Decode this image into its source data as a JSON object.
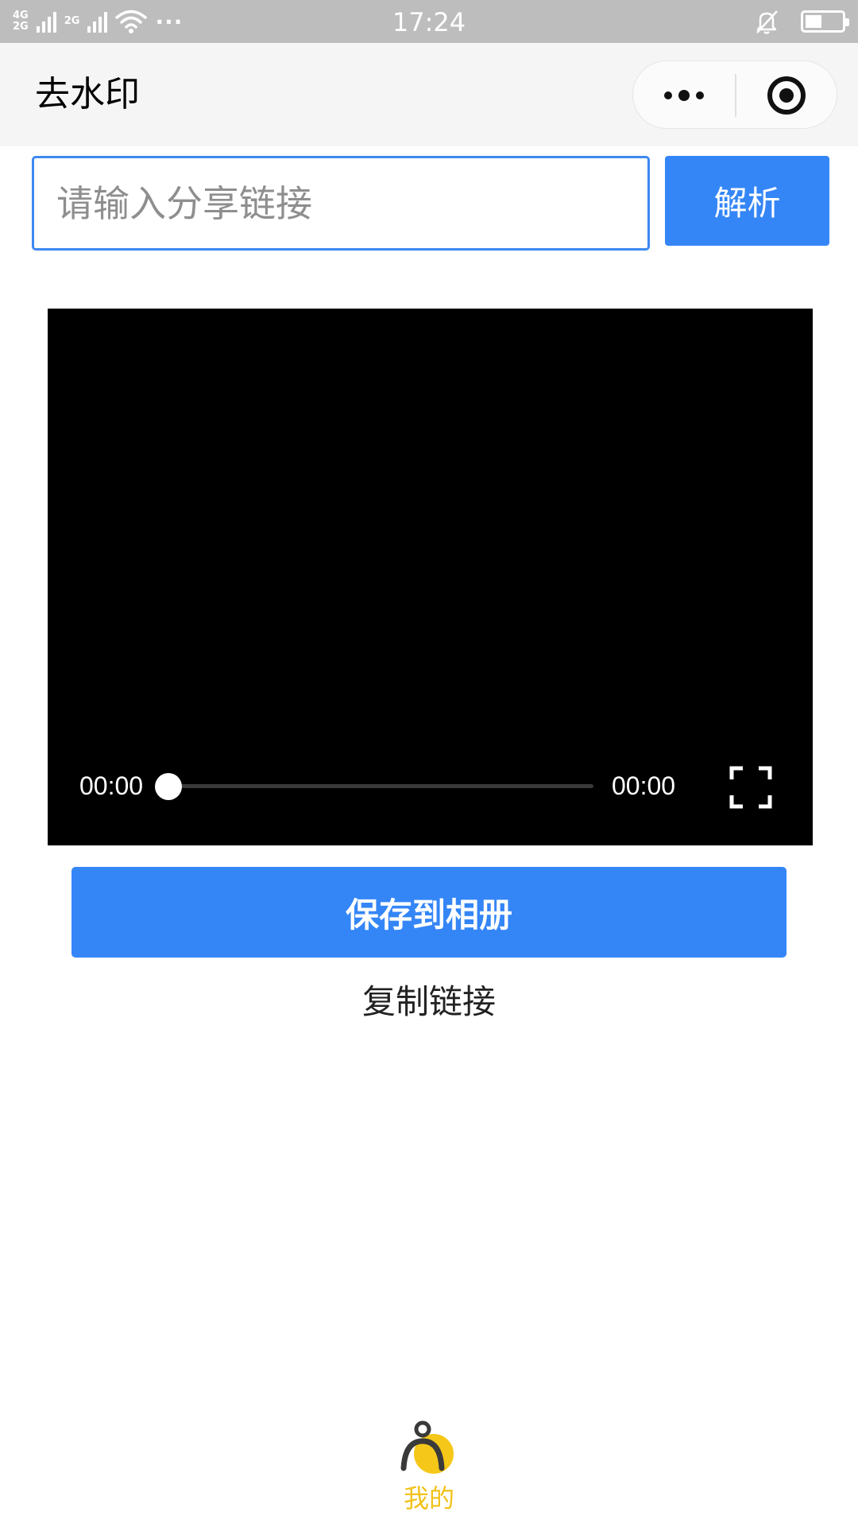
{
  "status_bar": {
    "network_top": "4G",
    "network_bottom": "2G",
    "network2": "2G",
    "more": "···",
    "time": "17:24",
    "battery_level": 0.45
  },
  "nav": {
    "title": "去水印",
    "more_icon": "more-dots-icon",
    "close_icon": "target-circle-icon"
  },
  "search": {
    "placeholder": "请输入分享链接",
    "value": "",
    "parse_label": "解析"
  },
  "video": {
    "current_time": "00:00",
    "total_time": "00:00",
    "progress": 0,
    "fullscreen_icon": "fullscreen-icon"
  },
  "actions": {
    "save_label": "保存到相册",
    "copy_label": "复制链接"
  },
  "tabbar": {
    "items": [
      {
        "label": "我的",
        "icon": "user-icon",
        "active": true
      }
    ]
  },
  "colors": {
    "primary": "#3486f7",
    "input_border": "#3d89f0",
    "tab_active": "#f2c21b",
    "status_bar": "#bdbdbd",
    "nav_bar": "#f5f5f5"
  }
}
